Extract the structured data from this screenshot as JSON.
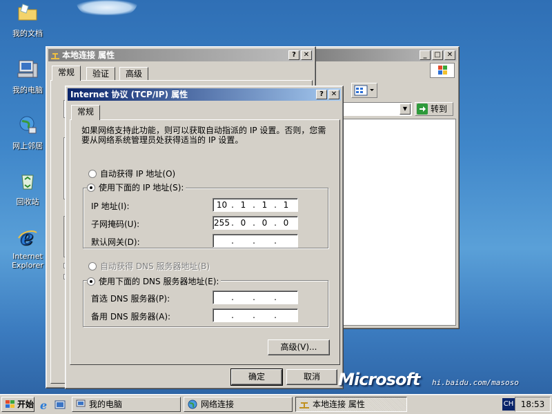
{
  "desktop": {
    "icons": [
      {
        "label": "我的文档"
      },
      {
        "label": "我的电脑"
      },
      {
        "label": "网上邻居"
      },
      {
        "label": "回收站"
      },
      {
        "label": "Internet Explorer"
      }
    ]
  },
  "explorer_window": {
    "go_label": "转到"
  },
  "props_window": {
    "title": "本地连接 属性",
    "tabs": [
      "常规",
      "验证",
      "高级"
    ]
  },
  "tcpip_dialog": {
    "title": "Internet 协议 (TCP/IP) 属性",
    "tab": "常规",
    "intro": "如果网络支持此功能，则可以获取自动指派的 IP 设置。否则，您需要从网络系统管理员处获得适当的 IP 设置。",
    "auto_ip": "自动获得 IP 地址(O)",
    "manual_ip": "使用下面的 IP 地址(S):",
    "ip_label": "IP 地址(I):",
    "ip_value": [
      "10",
      "1",
      "1",
      "1"
    ],
    "mask_label": "子网掩码(U):",
    "mask_value": [
      "255",
      "0",
      "0",
      "0"
    ],
    "gateway_label": "默认网关(D):",
    "gateway_value": [
      "",
      "",
      "",
      ""
    ],
    "auto_dns": "自动获得 DNS 服务器地址(B)",
    "manual_dns": "使用下面的 DNS 服务器地址(E):",
    "dns1_label": "首选 DNS 服务器(P):",
    "dns1_value": [
      "",
      "",
      "",
      ""
    ],
    "dns2_label": "备用 DNS 服务器(A):",
    "dns2_value": [
      "",
      "",
      "",
      ""
    ],
    "advanced": "高级(V)...",
    "ok": "确定",
    "cancel": "取消"
  },
  "taskbar": {
    "start": "开始",
    "tasks": [
      "我的电脑",
      "网络连接",
      "本地连接 属性"
    ],
    "lang": "CH",
    "clock": "18:53"
  },
  "branding": {
    "logo": "Microsoft",
    "watermark": "hi.baidu.com/masoso"
  }
}
